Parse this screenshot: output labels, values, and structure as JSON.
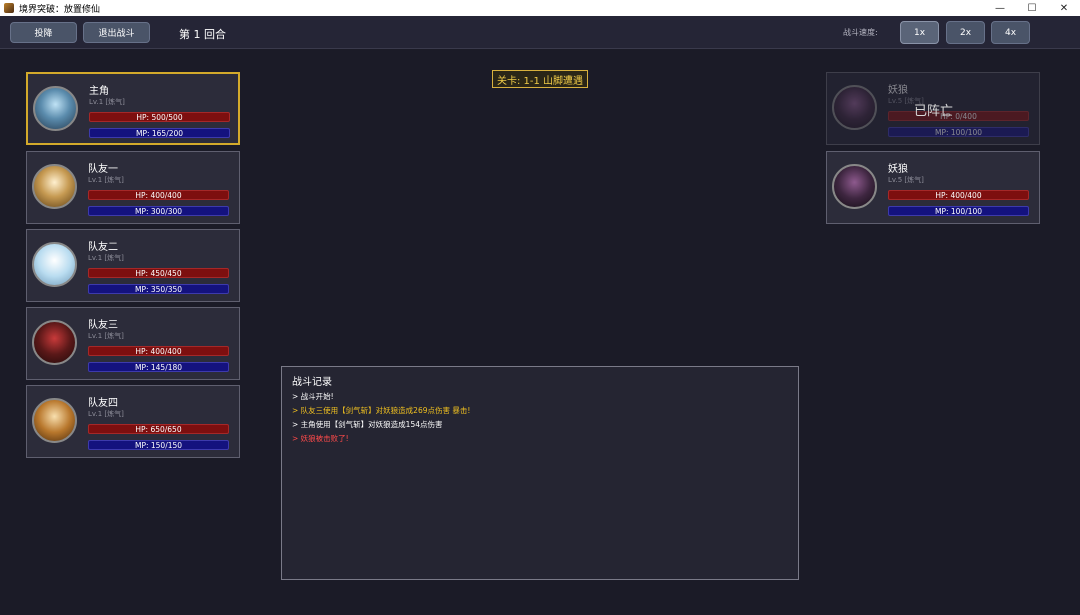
{
  "window": {
    "title": "境界突破：放置修仙",
    "minimize": "—",
    "maximize": "☐",
    "close": "✕"
  },
  "toolbar": {
    "surrender_label": "投降",
    "exit_label": "退出战斗",
    "round_label": "第 1 回合",
    "speed_label": "战斗速度:",
    "speeds": [
      "1x",
      "2x",
      "4x"
    ],
    "selected_speed": "1x"
  },
  "stage": {
    "label": "关卡: 1-1 山脚遭遇"
  },
  "allies": [
    {
      "name": "主角",
      "level": "Lv.1 [炼气]",
      "hp": "HP: 500/500",
      "mp": "MP: 165/200",
      "active": true,
      "avatar_icon": "hero-avatar"
    },
    {
      "name": "队友一",
      "level": "Lv.1 [炼气]",
      "hp": "HP: 400/400",
      "mp": "MP: 300/300",
      "active": false,
      "avatar_icon": "ally1-avatar"
    },
    {
      "name": "队友二",
      "level": "Lv.1 [炼气]",
      "hp": "HP: 450/450",
      "mp": "MP: 350/350",
      "active": false,
      "avatar_icon": "ally2-avatar"
    },
    {
      "name": "队友三",
      "level": "Lv.1 [炼气]",
      "hp": "HP: 400/400",
      "mp": "MP: 145/180",
      "active": false,
      "avatar_icon": "ally3-avatar"
    },
    {
      "name": "队友四",
      "level": "Lv.1 [炼气]",
      "hp": "HP: 650/650",
      "mp": "MP: 150/150",
      "active": false,
      "avatar_icon": "ally4-avatar"
    }
  ],
  "enemies": [
    {
      "name": "妖狼",
      "level": "Lv.5 [炼气]",
      "hp": "HP: 0/400",
      "mp": "MP: 100/100",
      "dead": true,
      "dead_label": "已阵亡",
      "avatar_icon": "wolf-avatar"
    },
    {
      "name": "妖狼",
      "level": "Lv.5 [炼气]",
      "hp": "HP: 400/400",
      "mp": "MP: 100/100",
      "dead": false,
      "avatar_icon": "wolf-avatar"
    }
  ],
  "battle_log": {
    "title": "战斗记录",
    "lines": [
      {
        "text": "> 战斗开始!",
        "color": "#ffffff"
      },
      {
        "text": "> 队友三使用【剑气斩】对妖狼造成269点伤害 暴击!",
        "color": "#f0c020"
      },
      {
        "text": "> 主角使用【剑气斩】对妖狼造成154点伤害",
        "color": "#ffffff"
      },
      {
        "text": "> 妖狼被击败了!",
        "color": "#ff4a4a"
      }
    ]
  },
  "colors": {
    "active_border": "#d3aa2b",
    "hp_bar": "#7d0f0f",
    "mp_bar": "#14127e",
    "stage_text": "#f0cb48"
  }
}
